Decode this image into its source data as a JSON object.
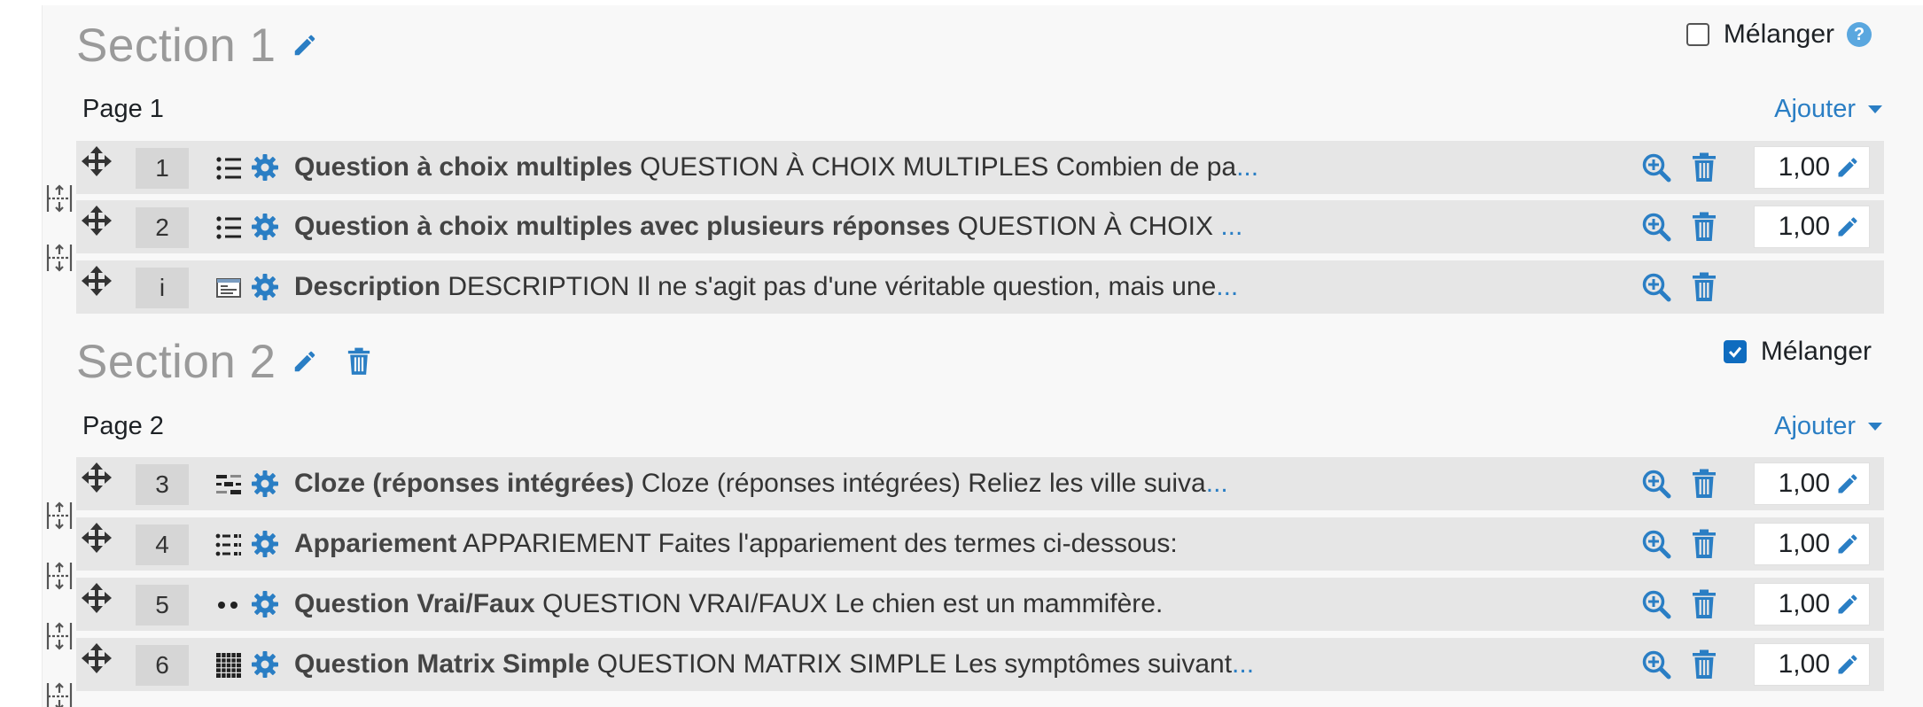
{
  "colors": {
    "accent": "#0f6cbf",
    "link": "#2a7ec4",
    "row_bg": "#e6e6e6",
    "panel_bg": "#f8f8f8",
    "section_title": "#9a9a9a"
  },
  "sections": [
    {
      "title": "Section 1",
      "shuffle": {
        "label": "Mélanger",
        "checked": false,
        "help": "?"
      },
      "pages": [
        {
          "label": "Page 1",
          "add_label": "Ajouter",
          "questions": [
            {
              "number": "1",
              "type_icon": "multichoice-icon",
              "name": "Question à choix multiples",
              "summary": "QUESTION À CHOIX MULTIPLES Combien de pa",
              "ellipsis": "...",
              "mark": "1,00"
            },
            {
              "number": "2",
              "type_icon": "multichoice-icon",
              "name": "Question à choix multiples avec plusieurs réponses",
              "summary": "QUESTION À CHOIX ",
              "ellipsis": "...",
              "mark": "1,00"
            },
            {
              "number": "i",
              "type_icon": "description-icon",
              "name": "Description",
              "summary": "DESCRIPTION Il ne s'agit pas d'une véritable question, mais une",
              "ellipsis": "...",
              "mark": ""
            }
          ]
        }
      ]
    },
    {
      "title": "Section 2",
      "shuffle": {
        "label": "Mélanger",
        "checked": true
      },
      "pages": [
        {
          "label": "Page 2",
          "add_label": "Ajouter",
          "questions": [
            {
              "number": "3",
              "type_icon": "cloze-icon",
              "name": "Cloze (réponses intégrées)",
              "summary": "Cloze (réponses intégrées) Reliez les ville suiva",
              "ellipsis": "...",
              "mark": "1,00"
            },
            {
              "number": "4",
              "type_icon": "matching-icon",
              "name": "Appariement",
              "summary": "APPARIEMENT Faites l'appariement des termes ci-dessous:",
              "ellipsis": "",
              "mark": "1,00"
            },
            {
              "number": "5",
              "type_icon": "truefalse-icon",
              "name": "Question Vrai/Faux",
              "summary": "QUESTION VRAI/FAUX Le chien est un mammifère.",
              "ellipsis": "",
              "mark": "1,00"
            },
            {
              "number": "6",
              "type_icon": "matrix-icon",
              "name": "Question Matrix Simple",
              "summary": "QUESTION MATRIX SIMPLE Les symptômes suivant",
              "ellipsis": "...",
              "mark": "1,00"
            }
          ]
        }
      ]
    }
  ]
}
